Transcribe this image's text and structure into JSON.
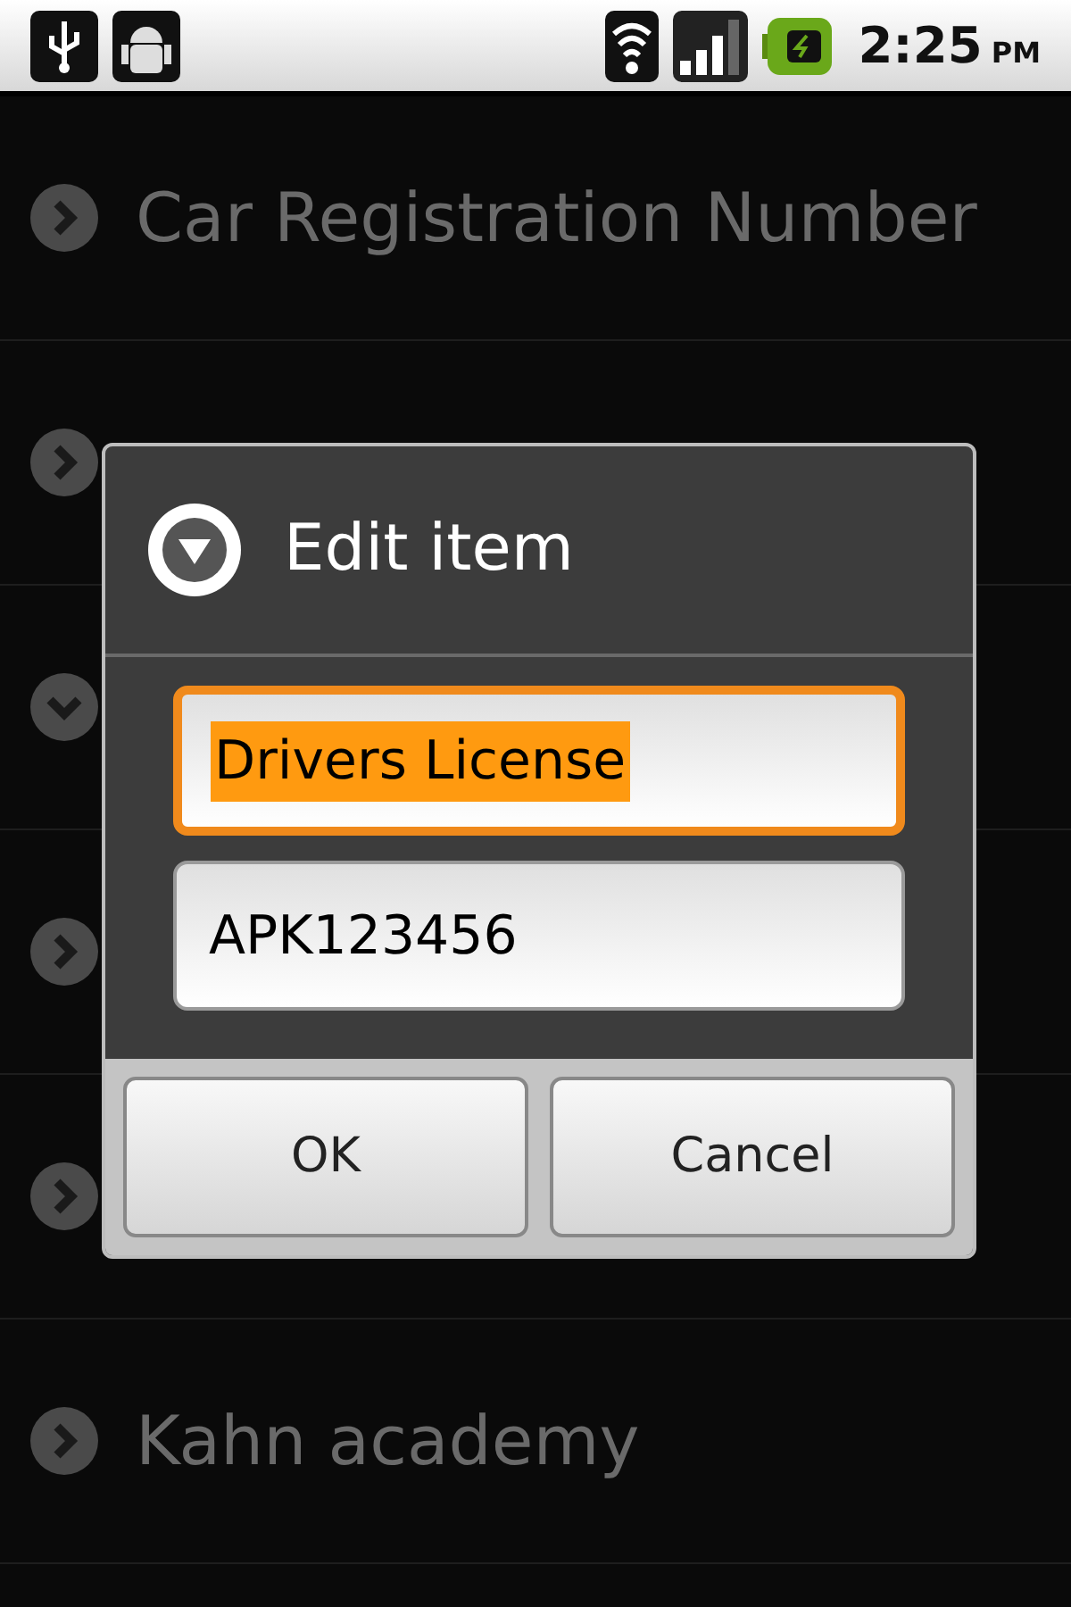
{
  "status_bar": {
    "time": "2:25",
    "ampm": "PM"
  },
  "list": [
    {
      "label": "Car Registration Number",
      "expanded": false
    },
    {
      "expanded": false
    },
    {
      "expanded": true
    },
    {
      "expanded": false
    },
    {
      "expanded": false
    },
    {
      "label": "Kahn academy",
      "expanded": false
    }
  ],
  "dialog": {
    "title": "Edit item",
    "fields": [
      {
        "value": "Drivers License",
        "focused": true,
        "text_selected": true
      },
      {
        "value": "APK123456",
        "focused": false,
        "text_selected": false
      }
    ],
    "buttons": [
      "OK",
      "Cancel"
    ]
  }
}
